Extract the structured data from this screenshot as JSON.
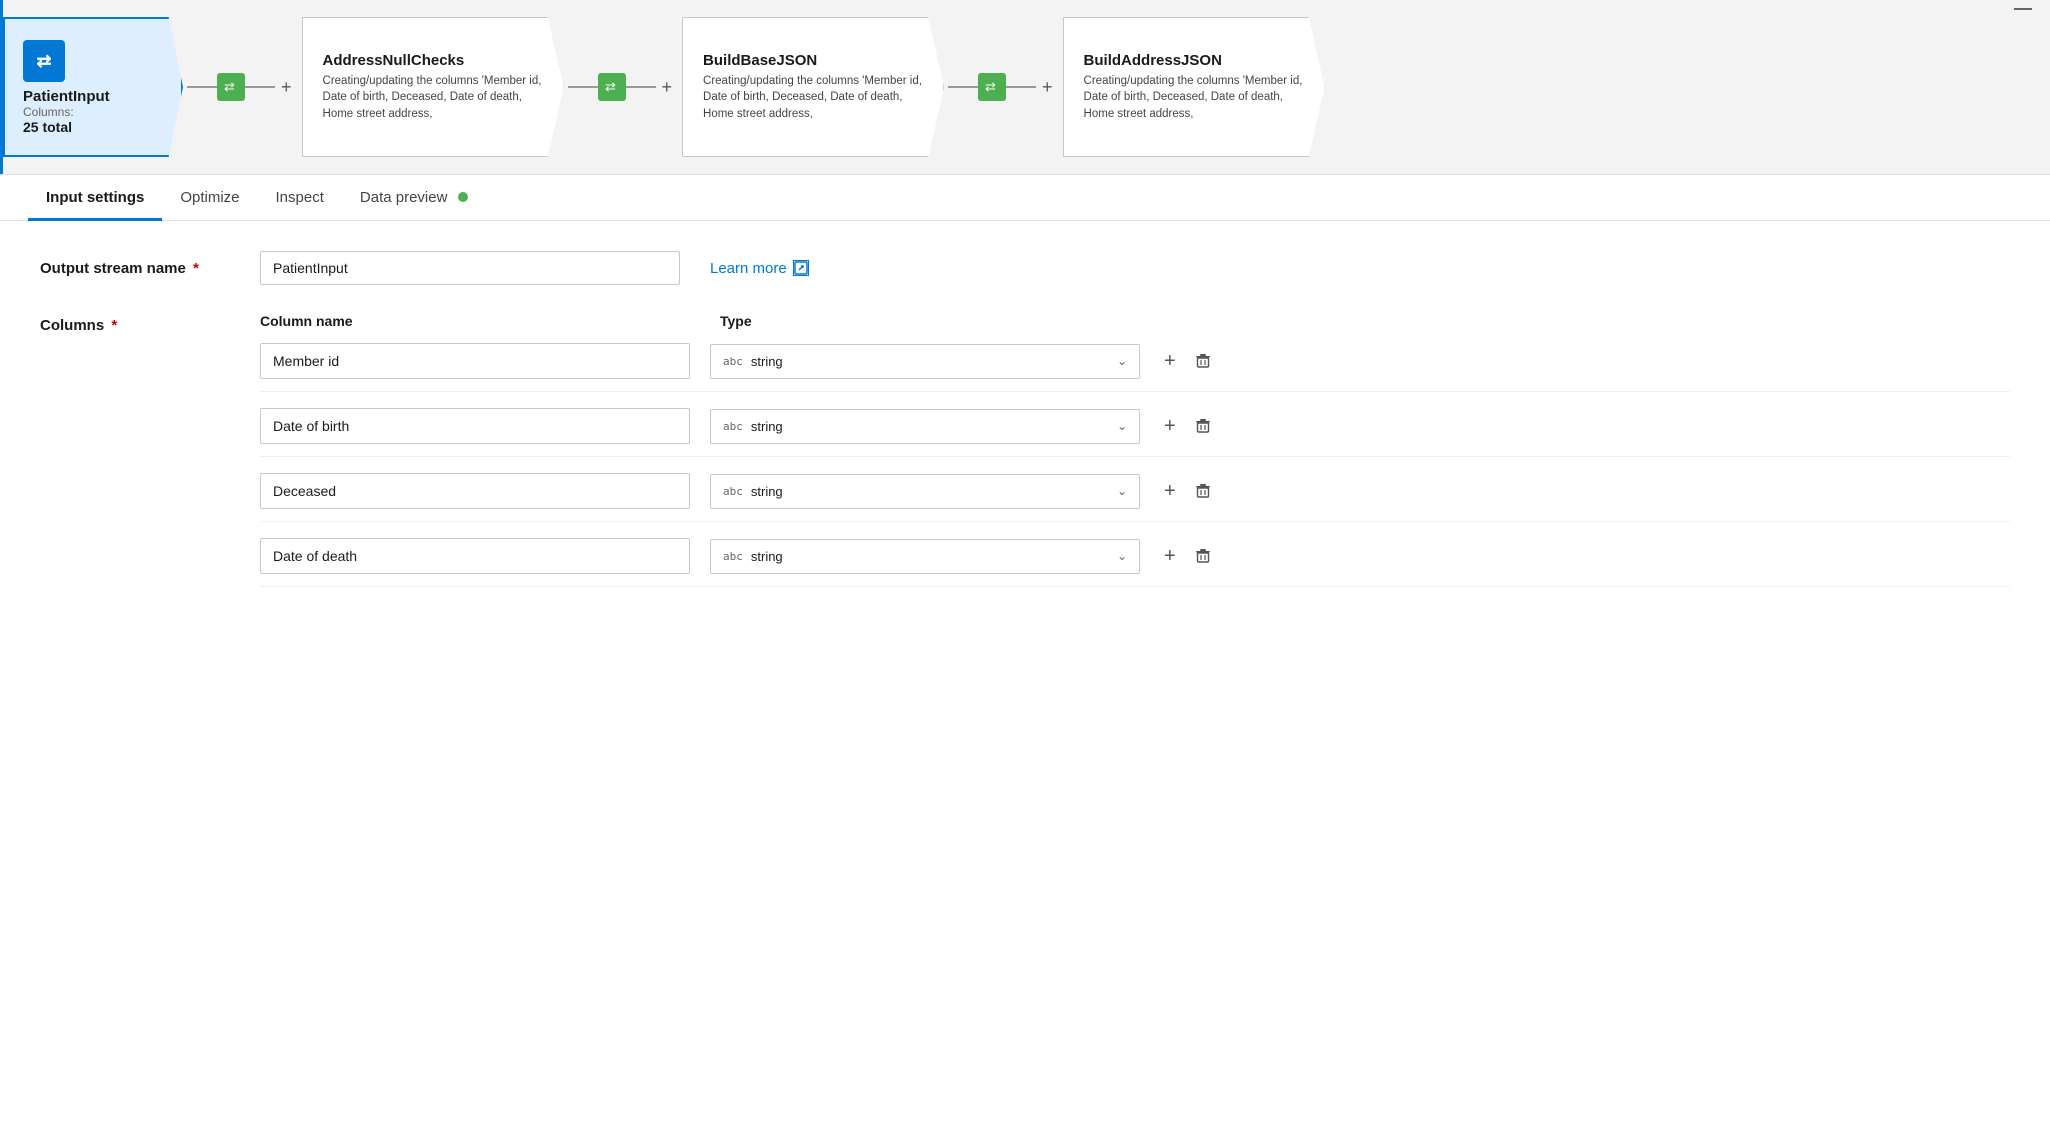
{
  "pipeline": {
    "nodes": [
      {
        "id": "patient-input",
        "title": "PatientInput",
        "subtitle": "Columns:",
        "count": "25 total",
        "type": "source",
        "active": true
      },
      {
        "id": "address-null-checks",
        "title": "AddressNullChecks",
        "desc": "Creating/updating the columns 'Member id, Date of birth, Deceased, Date of death, Home street address,",
        "type": "transform"
      },
      {
        "id": "build-base-json",
        "title": "BuildBaseJSON",
        "desc": "Creating/updating the columns 'Member id, Date of birth, Deceased, Date of death, Home street address,",
        "type": "transform"
      },
      {
        "id": "build-address-json",
        "title": "BuildAddressJSON",
        "desc": "Creating/updating the columns 'Member id, Date of birth, Deceased, Date of death, Home street address,",
        "type": "transform"
      }
    ]
  },
  "tabs": {
    "items": [
      {
        "label": "Input settings",
        "active": true
      },
      {
        "label": "Optimize",
        "active": false
      },
      {
        "label": "Inspect",
        "active": false
      },
      {
        "label": "Data preview",
        "active": false,
        "hasDot": true
      }
    ]
  },
  "settings": {
    "output_stream_label": "Output stream name",
    "output_stream_value": "PatientInput",
    "learn_more_label": "Learn more",
    "columns_label": "Columns",
    "col_name_header": "Column name",
    "col_type_header": "Type",
    "columns": [
      {
        "name": "Member id",
        "type": "string"
      },
      {
        "name": "Date of birth",
        "type": "string"
      },
      {
        "name": "Deceased",
        "type": "string"
      },
      {
        "name": "Date of death",
        "type": "string"
      }
    ]
  },
  "icons": {
    "source_icon": "⇄",
    "transform_icon": "⇄",
    "plus": "+",
    "chevron_down": "∨",
    "trash": "🗑",
    "external_link": "↗",
    "abc_badge": "abc"
  }
}
